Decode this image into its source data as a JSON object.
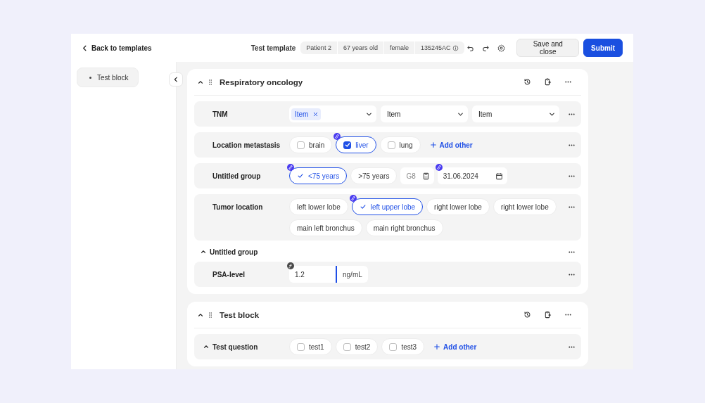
{
  "header": {
    "back_link": "Back to templates",
    "title": "Test template",
    "patient_tags": [
      {
        "label": "Patient 2",
        "info": false
      },
      {
        "label": "67 years old",
        "info": false
      },
      {
        "label": "female",
        "info": false
      },
      {
        "label": "135245AC",
        "info": true
      }
    ],
    "buttons": [
      {
        "label": "Save and close",
        "kind": "secondary"
      },
      {
        "label": "Submit",
        "kind": "primary"
      }
    ]
  },
  "sidebar": {
    "items": [
      {
        "label": "Test block"
      }
    ]
  },
  "blocks": [
    {
      "title": "Respiratory oncology",
      "expanded": true,
      "items": [
        {
          "kind": "question",
          "label": "TNM",
          "controls": [
            {
              "kind": "select",
              "tags": [
                "Item"
              ]
            },
            {
              "kind": "select",
              "value": "Item"
            },
            {
              "kind": "select",
              "value": "Item"
            }
          ]
        },
        {
          "kind": "question",
          "label": "Location metastasis",
          "controls": [
            {
              "kind": "checkbox",
              "label": "brain",
              "checked": false
            },
            {
              "kind": "checkbox",
              "label": "liver",
              "checked": true,
              "linked": true
            },
            {
              "kind": "checkbox",
              "label": "lung",
              "checked": false
            },
            {
              "kind": "add",
              "label": "Add other"
            }
          ]
        },
        {
          "kind": "question",
          "label": "Untitled group",
          "controls": [
            {
              "kind": "choice",
              "label": "<75 years",
              "selected": true,
              "linked": true
            },
            {
              "kind": "choice",
              "label": ">75 years",
              "selected": false
            },
            {
              "kind": "calc-field",
              "placeholder": "G8"
            },
            {
              "kind": "date",
              "value": "31.06.2024",
              "linked": true
            }
          ]
        },
        {
          "kind": "question",
          "label": "Tumor location",
          "controls": [
            {
              "kind": "choice",
              "label": "left lower lobe",
              "selected": false
            },
            {
              "kind": "choice",
              "label": "left upper lobe",
              "selected": true,
              "linked": true
            },
            {
              "kind": "choice",
              "label": "right lower lobe",
              "selected": false
            },
            {
              "kind": "choice",
              "label": "right lower lobe",
              "selected": false
            },
            {
              "kind": "choice",
              "label": "main left bronchus",
              "selected": false
            },
            {
              "kind": "choice",
              "label": "main right bronchus",
              "selected": false
            }
          ]
        },
        {
          "kind": "group",
          "label": "Untitled group",
          "expanded": true,
          "children": [
            {
              "kind": "question",
              "label": "PSA-level",
              "controls": [
                {
                  "kind": "number",
                  "value": "1.2",
                  "unit": "ng/mL",
                  "focused": true,
                  "formula": true
                }
              ]
            }
          ]
        }
      ]
    },
    {
      "title": "Test block",
      "expanded": true,
      "items": [
        {
          "kind": "question",
          "label": "Test question",
          "expanded": true,
          "controls": [
            {
              "kind": "checkbox",
              "label": "test1",
              "checked": false
            },
            {
              "kind": "checkbox",
              "label": "test2",
              "checked": false
            },
            {
              "kind": "checkbox",
              "label": "test3",
              "checked": false
            },
            {
              "kind": "add",
              "label": "Add other"
            }
          ]
        }
      ]
    }
  ]
}
